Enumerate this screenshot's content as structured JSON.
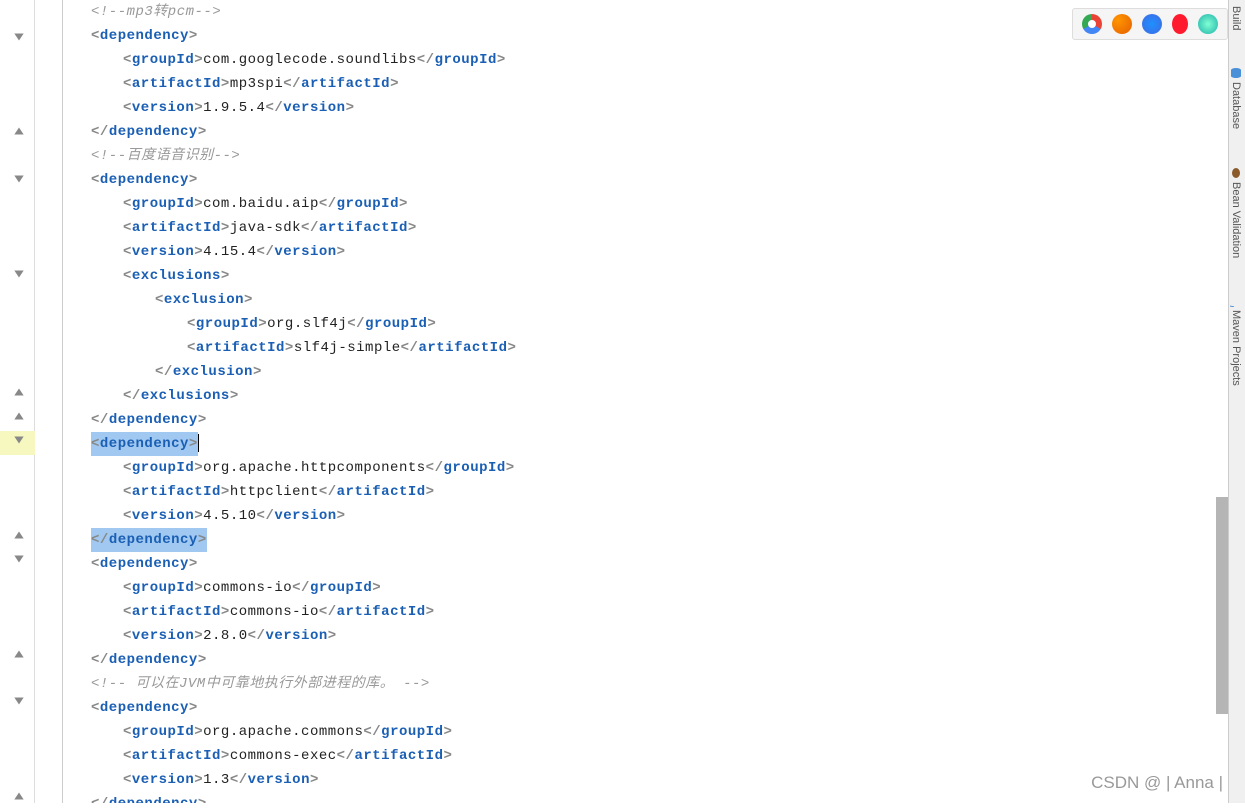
{
  "comments": {
    "mp3pcm": "<!--mp3转pcm-->",
    "baidu": "<!--百度语音识别-->",
    "jvm": "<!-- 可以在JVM中可靠地执行外部进程的库。 -->"
  },
  "dependencies": [
    {
      "groupId": "com.googlecode.soundlibs",
      "artifactId": "mp3spi",
      "version": "1.9.5.4"
    },
    {
      "groupId": "com.baidu.aip",
      "artifactId": "java-sdk",
      "version": "4.15.4",
      "exclusions": [
        {
          "groupId": "org.slf4j",
          "artifactId": "slf4j-simple"
        }
      ]
    },
    {
      "groupId": "org.apache.httpcomponents",
      "artifactId": "httpclient",
      "version": "4.5.10"
    },
    {
      "groupId": "commons-io",
      "artifactId": "commons-io",
      "version": "2.8.0"
    },
    {
      "groupId": "org.apache.commons",
      "artifactId": "commons-exec",
      "version": "1.3"
    }
  ],
  "tags": {
    "dependency": "dependency",
    "groupId": "groupId",
    "artifactId": "artifactId",
    "version": "version",
    "exclusions": "exclusions",
    "exclusion": "exclusion"
  },
  "sidebar": {
    "build": "Build",
    "database": "Database",
    "bean_validation": "Bean Validation",
    "maven_projects": "Maven Projects"
  },
  "browsers": [
    "chrome",
    "firefox",
    "safari",
    "opera",
    "netscape"
  ],
  "watermark": "CSDN @ | Anna |",
  "colors": {
    "tag": "#1a5fb4",
    "comment": "#999999",
    "bracket": "#888888",
    "selection": "#a0c8f0",
    "highlight_line": "#fffff3"
  },
  "fold_positions": [
    36,
    130,
    178,
    273,
    391,
    415,
    439,
    524,
    558,
    653,
    700,
    795
  ]
}
